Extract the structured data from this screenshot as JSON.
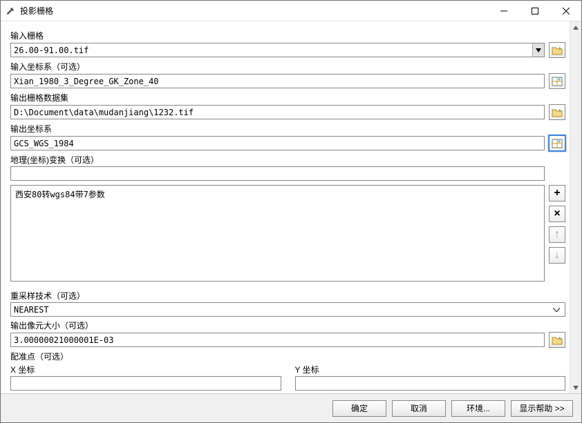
{
  "window": {
    "title": "投影栅格"
  },
  "labels": {
    "input_raster": "输入栅格",
    "input_crs": "输入坐标系（可选）",
    "output_dataset": "输出栅格数据集",
    "output_crs": "输出坐标系",
    "geo_transform": "地理(坐标)变换（可选）",
    "resample": "重采样技术（可选）",
    "cell_size": "输出像元大小（可选）",
    "reg_point": "配准点（可选）",
    "x_coord": "X 坐标",
    "y_coord": "Y 坐标"
  },
  "values": {
    "input_raster": "26.00-91.00.tif",
    "input_crs": "Xian_1980_3_Degree_GK_Zone_40",
    "output_dataset": "D:\\Document\\data\\mudanjiang\\1232.tif",
    "output_crs": "GCS_WGS_1984",
    "geo_transform": "",
    "resample": "NEAREST",
    "cell_size": "3.00000021000001E-03",
    "x_coord": "",
    "y_coord": ""
  },
  "transform_list": [
    "西安80转wgs84带7参数"
  ],
  "footer": {
    "ok": "确定",
    "cancel": "取消",
    "env": "环境...",
    "help": "显示帮助 >>"
  }
}
